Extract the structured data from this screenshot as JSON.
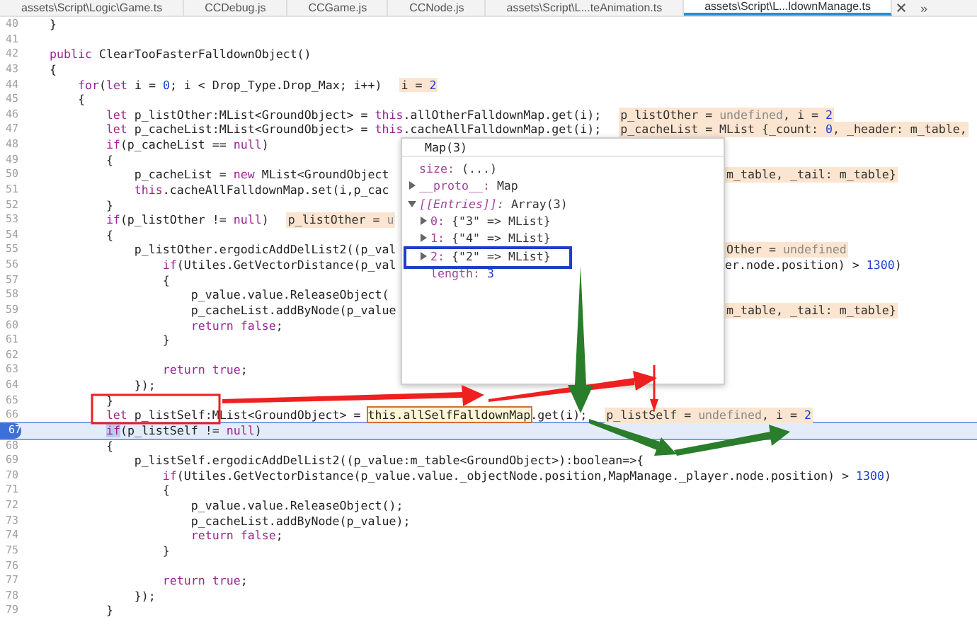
{
  "tabs": [
    {
      "label": "assets\\Script\\Logic\\Game.ts",
      "selected": false
    },
    {
      "label": "CCDebug.js",
      "selected": false
    },
    {
      "label": "CCGame.js",
      "selected": false
    },
    {
      "label": "CCNode.js",
      "selected": false
    },
    {
      "label": "assets\\Script\\L...teAnimation.ts",
      "selected": false
    },
    {
      "label": "assets\\Script\\L...ldownManage.ts",
      "selected": true
    }
  ],
  "tabs_overflow": "»",
  "lines": [
    {
      "number": "40",
      "current": false,
      "code": [
        {
          "kind": "t",
          "text": "    }"
        }
      ]
    },
    {
      "number": "41",
      "current": false
    },
    {
      "number": "42",
      "current": false,
      "code": [
        {
          "kind": "k",
          "text": "    public"
        },
        {
          "kind": "t",
          "text": " ClearTooFasterFalldownObject()"
        }
      ]
    },
    {
      "number": "43",
      "current": false,
      "code": [
        {
          "kind": "t",
          "text": "    {"
        }
      ]
    },
    {
      "number": "44",
      "current": false,
      "code": [
        {
          "kind": "k",
          "text": "        for"
        },
        {
          "kind": "t",
          "text": "("
        },
        {
          "kind": "k",
          "text": "let"
        },
        {
          "kind": "t",
          "text": " i = "
        },
        {
          "kind": "n",
          "text": "0"
        },
        {
          "kind": "t",
          "text": "; i < Drop_Type.Drop_Max; i++)"
        }
      ],
      "hint": [
        {
          "kind": "t",
          "text": "i = "
        },
        {
          "kind": "n",
          "text": "2"
        }
      ]
    },
    {
      "number": "45",
      "current": false,
      "code": [
        {
          "kind": "t",
          "text": "        {"
        }
      ]
    },
    {
      "number": "46",
      "current": false,
      "code": [
        {
          "kind": "k",
          "text": "            let"
        },
        {
          "kind": "t",
          "text": " p_listOther:MList<GroundObject> = "
        },
        {
          "kind": "k",
          "text": "this"
        },
        {
          "kind": "t",
          "text": ".allOtherFalldownMap.get(i);"
        }
      ],
      "hint": [
        {
          "kind": "t",
          "text": "p_listOther = "
        },
        {
          "kind": "u",
          "text": "undefined"
        },
        {
          "kind": "t",
          "text": ", i = "
        },
        {
          "kind": "n",
          "text": "2"
        }
      ]
    },
    {
      "number": "47",
      "current": false,
      "code": [
        {
          "kind": "k",
          "text": "            let"
        },
        {
          "kind": "t",
          "text": " p_cacheList:MList<GroundObject> = "
        },
        {
          "kind": "k",
          "text": "this"
        },
        {
          "kind": "t",
          "text": ".cacheAllFalldownMap.get(i);"
        }
      ],
      "hint": [
        {
          "kind": "t",
          "text": "p_cacheList = MList {_count: "
        },
        {
          "kind": "n",
          "text": "0"
        },
        {
          "kind": "t",
          "text": ", _header: m_table,"
        }
      ]
    },
    {
      "number": "48",
      "current": false,
      "code": [
        {
          "kind": "k",
          "text": "            if"
        },
        {
          "kind": "t",
          "text": "(p_cacheList == "
        },
        {
          "kind": "k",
          "text": "null"
        },
        {
          "kind": "t",
          "text": ")"
        }
      ]
    },
    {
      "number": "49",
      "current": false,
      "code": [
        {
          "kind": "t",
          "text": "            {"
        }
      ]
    },
    {
      "number": "50",
      "current": false,
      "code": [
        {
          "kind": "t",
          "text": "                p_cacheList = "
        },
        {
          "kind": "k",
          "text": "new"
        },
        {
          "kind": "t",
          "text": " MList<GroundObject"
        }
      ],
      "right": {
        "kind": "hint",
        "segments": [
          {
            "kind": "t",
            "text": "m_table, _tail: m_table}"
          }
        ]
      }
    },
    {
      "number": "51",
      "current": false,
      "code": [
        {
          "kind": "k",
          "text": "                this"
        },
        {
          "kind": "t",
          "text": ".cacheAllFalldownMap.set(i,p_cac"
        }
      ]
    },
    {
      "number": "52",
      "current": false,
      "code": [
        {
          "kind": "t",
          "text": "            }"
        }
      ]
    },
    {
      "number": "53",
      "current": false,
      "code": [
        {
          "kind": "k",
          "text": "            if"
        },
        {
          "kind": "t",
          "text": "(p_listOther != "
        },
        {
          "kind": "k",
          "text": "null"
        },
        {
          "kind": "t",
          "text": ")"
        }
      ],
      "hint": [
        {
          "kind": "t",
          "text": "p_listOther = "
        },
        {
          "kind": "u",
          "text": "u"
        }
      ]
    },
    {
      "number": "54",
      "current": false,
      "code": [
        {
          "kind": "t",
          "text": "            {"
        }
      ]
    },
    {
      "number": "55",
      "current": false,
      "code": [
        {
          "kind": "t",
          "text": "                p_listOther.ergodicAddDelList2((p_val"
        }
      ],
      "right": {
        "kind": "hint",
        "segments": [
          {
            "kind": "t",
            "text": "Other = "
          },
          {
            "kind": "u",
            "text": "undefined"
          }
        ]
      }
    },
    {
      "number": "56",
      "current": false,
      "code": [
        {
          "kind": "k",
          "text": "                    if"
        },
        {
          "kind": "t",
          "text": "(Utiles.GetVectorDistance(p_val"
        }
      ],
      "right": {
        "kind": "code",
        "segments": [
          {
            "kind": "t",
            "text": "er.node.position) > "
          },
          {
            "kind": "n",
            "text": "1300"
          },
          {
            "kind": "t",
            "text": ")"
          }
        ]
      }
    },
    {
      "number": "57",
      "current": false,
      "code": [
        {
          "kind": "t",
          "text": "                    {"
        }
      ]
    },
    {
      "number": "58",
      "current": false,
      "code": [
        {
          "kind": "t",
          "text": "                        p_value.value.ReleaseObject("
        }
      ]
    },
    {
      "number": "59",
      "current": false,
      "code": [
        {
          "kind": "t",
          "text": "                        p_cacheList.addByNode(p_value"
        }
      ],
      "right": {
        "kind": "hint",
        "segments": [
          {
            "kind": "t",
            "text": "m_table, _tail: m_table}"
          }
        ]
      }
    },
    {
      "number": "60",
      "current": false,
      "code": [
        {
          "kind": "k",
          "text": "                        return false"
        },
        {
          "kind": "t",
          "text": ";"
        }
      ]
    },
    {
      "number": "61",
      "current": false,
      "code": [
        {
          "kind": "t",
          "text": "                    }"
        }
      ]
    },
    {
      "number": "62",
      "current": false
    },
    {
      "number": "63",
      "current": false,
      "code": [
        {
          "kind": "k",
          "text": "                    return true"
        },
        {
          "kind": "t",
          "text": ";"
        }
      ]
    },
    {
      "number": "64",
      "current": false,
      "code": [
        {
          "kind": "t",
          "text": "                });"
        }
      ]
    },
    {
      "number": "65",
      "current": false,
      "code": [
        {
          "kind": "t",
          "text": "            }"
        }
      ]
    },
    {
      "number": "66",
      "current": false,
      "code": [
        {
          "kind": "k",
          "text": "            let"
        },
        {
          "kind": "t",
          "text": " p_listSelf:MList<GroundObject> = "
        },
        {
          "kind": "m",
          "text": "this.allSelfFalldownMap"
        },
        {
          "kind": "t",
          "text": ".get(i);"
        }
      ],
      "hint": [
        {
          "kind": "t",
          "text": "p_listSelf = "
        },
        {
          "kind": "u",
          "text": "undefined"
        },
        {
          "kind": "t",
          "text": ", i = "
        },
        {
          "kind": "n",
          "text": "2"
        }
      ]
    },
    {
      "number": "67",
      "current": true,
      "code": [
        {
          "kind": "s",
          "text": "            if"
        },
        {
          "kind": "t",
          "text": "(p_listSelf != "
        },
        {
          "kind": "k",
          "text": "null"
        },
        {
          "kind": "t",
          "text": ")"
        }
      ]
    },
    {
      "number": "68",
      "current": false,
      "code": [
        {
          "kind": "t",
          "text": "            {"
        }
      ]
    },
    {
      "number": "69",
      "current": false,
      "code": [
        {
          "kind": "t",
          "text": "                p_listSelf.ergodicAddDelList2((p_value:m_table<GroundObject>):boolean=>{"
        }
      ]
    },
    {
      "number": "70",
      "current": false,
      "code": [
        {
          "kind": "k",
          "text": "                    if"
        },
        {
          "kind": "t",
          "text": "(Utiles.GetVectorDistance(p_value.value._objectNode.position,MapManage._player.node.position) > "
        },
        {
          "kind": "n",
          "text": "1300"
        },
        {
          "kind": "t",
          "text": ")"
        }
      ]
    },
    {
      "number": "71",
      "current": false,
      "code": [
        {
          "kind": "t",
          "text": "                    {"
        }
      ]
    },
    {
      "number": "72",
      "current": false,
      "code": [
        {
          "kind": "t",
          "text": "                        p_value.value.ReleaseObject();"
        }
      ]
    },
    {
      "number": "73",
      "current": false,
      "code": [
        {
          "kind": "t",
          "text": "                        p_cacheList.addByNode(p_value);"
        }
      ]
    },
    {
      "number": "74",
      "current": false,
      "code": [
        {
          "kind": "k",
          "text": "                        return false"
        },
        {
          "kind": "t",
          "text": ";"
        }
      ]
    },
    {
      "number": "75",
      "current": false,
      "code": [
        {
          "kind": "t",
          "text": "                    }"
        }
      ]
    },
    {
      "number": "76",
      "current": false
    },
    {
      "number": "77",
      "current": false,
      "code": [
        {
          "kind": "k",
          "text": "                    return true"
        },
        {
          "kind": "t",
          "text": ";"
        }
      ]
    },
    {
      "number": "78",
      "current": false,
      "code": [
        {
          "kind": "t",
          "text": "                });"
        }
      ]
    },
    {
      "number": "79",
      "current": false,
      "code": [
        {
          "kind": "t",
          "text": "            }"
        }
      ]
    }
  ],
  "popup": {
    "title": "Map(3)",
    "items": [
      {
        "key": "size:",
        "value": "(...)",
        "kind": "leaf",
        "internal": false
      },
      {
        "key": "__proto__:",
        "value": "Map",
        "kind": "node",
        "expanded": false,
        "internal": false
      },
      {
        "key": "[[Entries]]:",
        "value": "Array(3)",
        "kind": "node",
        "expanded": true,
        "internal": true,
        "children": [
          {
            "key": "0:",
            "value": "{\"3\" => MList}",
            "kind": "node",
            "expanded": false,
            "internal": false
          },
          {
            "key": "1:",
            "value": "{\"4\" => MList}",
            "kind": "node",
            "expanded": false,
            "internal": false
          },
          {
            "key": "2:",
            "value": "{\"2\" => MList}",
            "kind": "node",
            "expanded": false,
            "internal": false
          },
          {
            "key": "length:",
            "value": "3",
            "kind": "leaf",
            "internal": false
          }
        ]
      }
    ]
  }
}
